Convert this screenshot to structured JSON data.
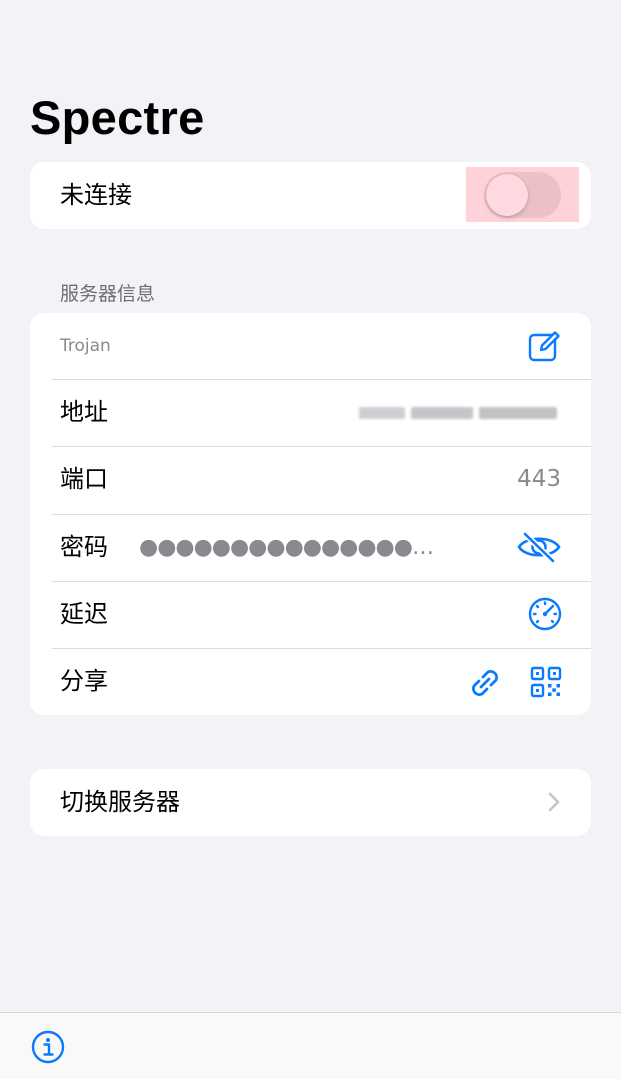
{
  "app": {
    "title": "Spectre"
  },
  "connection": {
    "status_label": "未连接",
    "enabled": false
  },
  "server_info": {
    "header": "服务器信息",
    "protocol": "Trojan",
    "address_label": "地址",
    "port_label": "端口",
    "port_value": "443",
    "password_label": "密码",
    "password_mask": "●●●●●●●●●●●●●●●…",
    "latency_label": "延迟",
    "share_label": "分享"
  },
  "switch_server": {
    "label": "切换服务器"
  },
  "colors": {
    "accent": "#0a7aff",
    "background": "#f2f2f7",
    "secondary_text": "#8a8a8e"
  },
  "icons": {
    "edit": "square-and-pencil-icon",
    "password_visibility": "eye-slash-icon",
    "latency": "speedometer-icon",
    "share_link": "link-icon",
    "share_qr": "qrcode-icon",
    "chevron": "chevron-right-icon",
    "info": "info-circle-icon"
  }
}
